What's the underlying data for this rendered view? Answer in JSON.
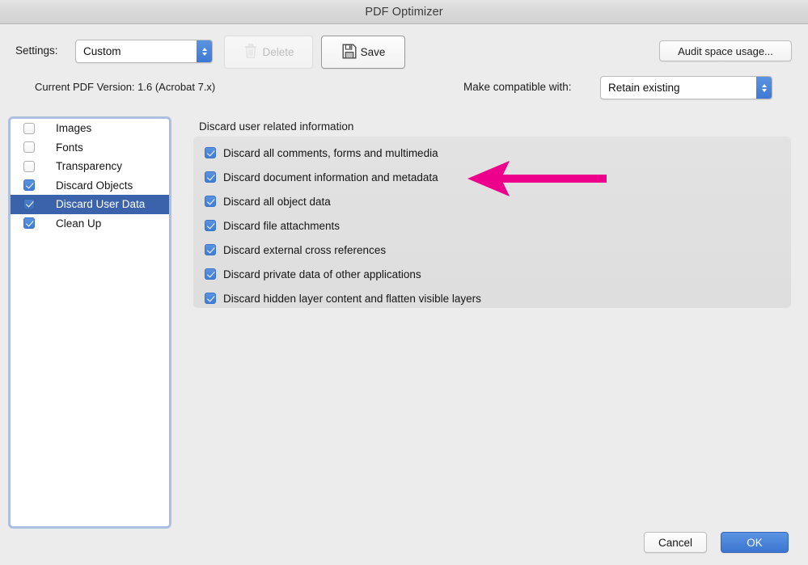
{
  "window": {
    "title": "PDF Optimizer"
  },
  "toolbar": {
    "settings_label": "Settings:",
    "settings_value": "Custom",
    "delete_label": "Delete",
    "delete_icon": "trash-icon",
    "save_label": "Save",
    "save_icon": "floppy-disk-icon",
    "audit_label": "Audit space usage..."
  },
  "info": {
    "pdf_version": "Current PDF Version: 1.6 (Acrobat 7.x)",
    "compat_label": "Make compatible with:",
    "compat_value": "Retain existing"
  },
  "sidebar": {
    "items": [
      {
        "label": "Images",
        "checked": false,
        "selected": false
      },
      {
        "label": "Fonts",
        "checked": false,
        "selected": false
      },
      {
        "label": "Transparency",
        "checked": false,
        "selected": false
      },
      {
        "label": "Discard Objects",
        "checked": true,
        "selected": false
      },
      {
        "label": "Discard User Data",
        "checked": true,
        "selected": true
      },
      {
        "label": "Clean Up",
        "checked": true,
        "selected": false
      }
    ]
  },
  "panel": {
    "title": "Discard user related information",
    "options": [
      {
        "label": "Discard all comments, forms and multimedia",
        "checked": true
      },
      {
        "label": "Discard document information and metadata",
        "checked": true
      },
      {
        "label": "Discard all object data",
        "checked": true
      },
      {
        "label": "Discard file attachments",
        "checked": true
      },
      {
        "label": "Discard external cross references",
        "checked": true
      },
      {
        "label": "Discard private data of other applications",
        "checked": true
      },
      {
        "label": "Discard hidden layer content and flatten visible layers",
        "checked": true
      }
    ]
  },
  "footer": {
    "cancel_label": "Cancel",
    "ok_label": "OK"
  },
  "annotation": {
    "name": "pink-arrow-pointing-to-discard-document-information-and-metadata",
    "color": "#EC008C",
    "points_to": "Discard document information and metadata"
  },
  "colors": {
    "accent_blue": "#3F7ED6",
    "selection_blue": "#3B63AB",
    "window_background": "#ECECEC",
    "annotation_pink": "#EC008C"
  }
}
